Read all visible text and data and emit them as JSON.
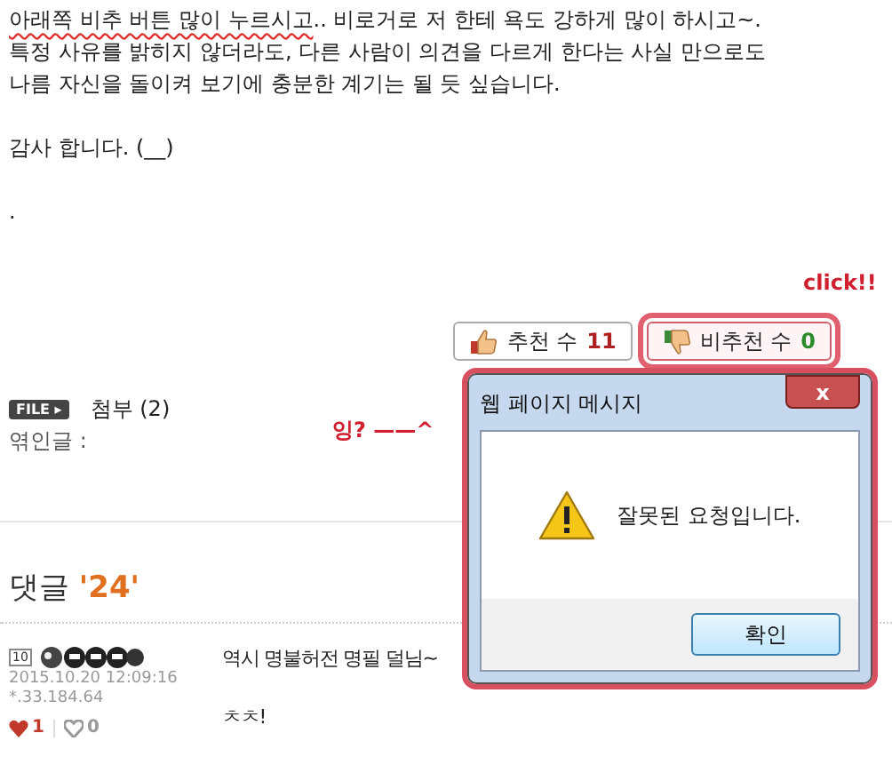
{
  "post": {
    "paragraphs": [
      {
        "lines": [
          {
            "underlined": "아래쪽 비추 버튼 많이 누르시고",
            "text": ".. 비로거로 저 한테 욕도 강하게 많이 하시고~."
          },
          {
            "text": "특정 사유를 밝히지 않더라도, 다른 사람이 의견을 다르게 한다는 사실 만으로도"
          },
          {
            "text": "나름 자신을 돌이켜 보기에 충분한 계기는 될 듯 싶습니다."
          }
        ]
      },
      {
        "lines": [
          {
            "text": "감사 합니다. (__)"
          }
        ]
      },
      {
        "lines": [
          {
            "text": "."
          }
        ]
      }
    ]
  },
  "votes": [
    {
      "label": "추천 수",
      "count": "11",
      "kind": "up",
      "highlighted": false
    },
    {
      "label": "비추천 수",
      "count": "0",
      "kind": "down",
      "highlighted": true
    }
  ],
  "annotations": {
    "click": "click!!",
    "huh": "잉? ——^"
  },
  "attachment": {
    "badge": "FILE ▸",
    "label": "첨부 (2)"
  },
  "linked_posts": {
    "label": "엮인글 :"
  },
  "dialog": {
    "title": "웹 페이지 메시지",
    "close": "x",
    "message": "잘못된 요청입니다.",
    "button": "확인"
  },
  "comments": {
    "title": "댓글",
    "count": "'24'",
    "items": [
      {
        "level": "10",
        "date": "2015.10.20 12:09:16",
        "ip": "*.33.184.64",
        "likes": "1",
        "dislikes": "0",
        "lines": [
          "역시 명불허전 명필 덜님~",
          "ㅊㅊ!"
        ]
      }
    ]
  }
}
